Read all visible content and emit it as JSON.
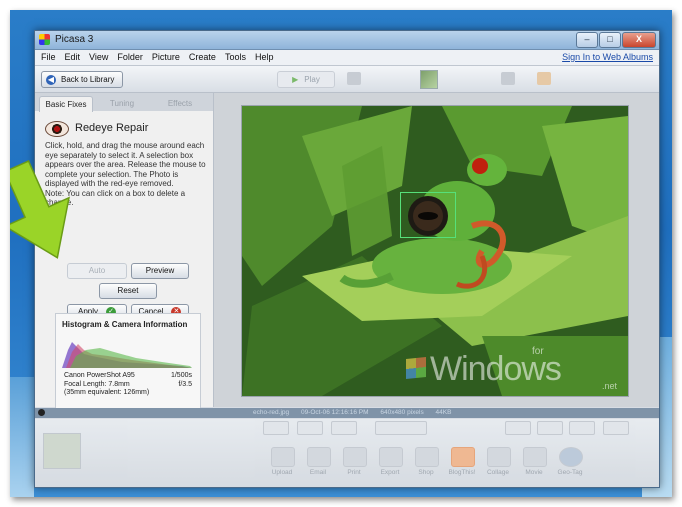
{
  "window": {
    "title": "Picasa 3",
    "minimize": "–",
    "maximize": "□",
    "close": "X"
  },
  "menu": [
    "File",
    "Edit",
    "View",
    "Folder",
    "Picture",
    "Create",
    "Tools",
    "Help"
  ],
  "signin": "Sign In to Web Albums",
  "toolbar": {
    "back_label": "Back to Library",
    "play_label": "Play"
  },
  "tabs": [
    "Basic Fixes",
    "Tuning",
    "Effects"
  ],
  "tool": {
    "title": "Redeye Repair",
    "description": "Click, hold, and drag the mouse around each eye separately to select it. A selection box appears over the area.  Release the mouse to complete your selection. The Photo is displayed with the red-eye removed.\nNote: You can click on a box to delete a change.",
    "buttons": {
      "auto": "Auto",
      "preview": "Preview",
      "reset": "Reset",
      "apply": "Apply",
      "cancel": "Cancel"
    }
  },
  "histogram": {
    "title": "Histogram & Camera Information",
    "camera": "Canon PowerShot A95",
    "shutter": "1/500s",
    "focal": "Focal Length: 7.8mm",
    "aperture": "f/3.5",
    "equivalent": "(35mm equivalent: 126mm)"
  },
  "watermark": {
    "main": "Windows",
    "for": "for",
    "net": ".net"
  },
  "status": {
    "filename": "echo-red.jpg",
    "date": "09-Oct-06 12:16:16 PM",
    "dims": "640x480 pixels",
    "size": "44KB"
  },
  "bottom_actions": [
    "Upload",
    "Email",
    "Print",
    "Export",
    "Shop",
    "BlogThis!",
    "Collage",
    "Movie",
    "Geo-Tag"
  ],
  "colors": {
    "accent": "#2f64b8",
    "apply_ok": "#3c9c3a",
    "cancel_x": "#c8382a",
    "selection": "#56e07a"
  }
}
